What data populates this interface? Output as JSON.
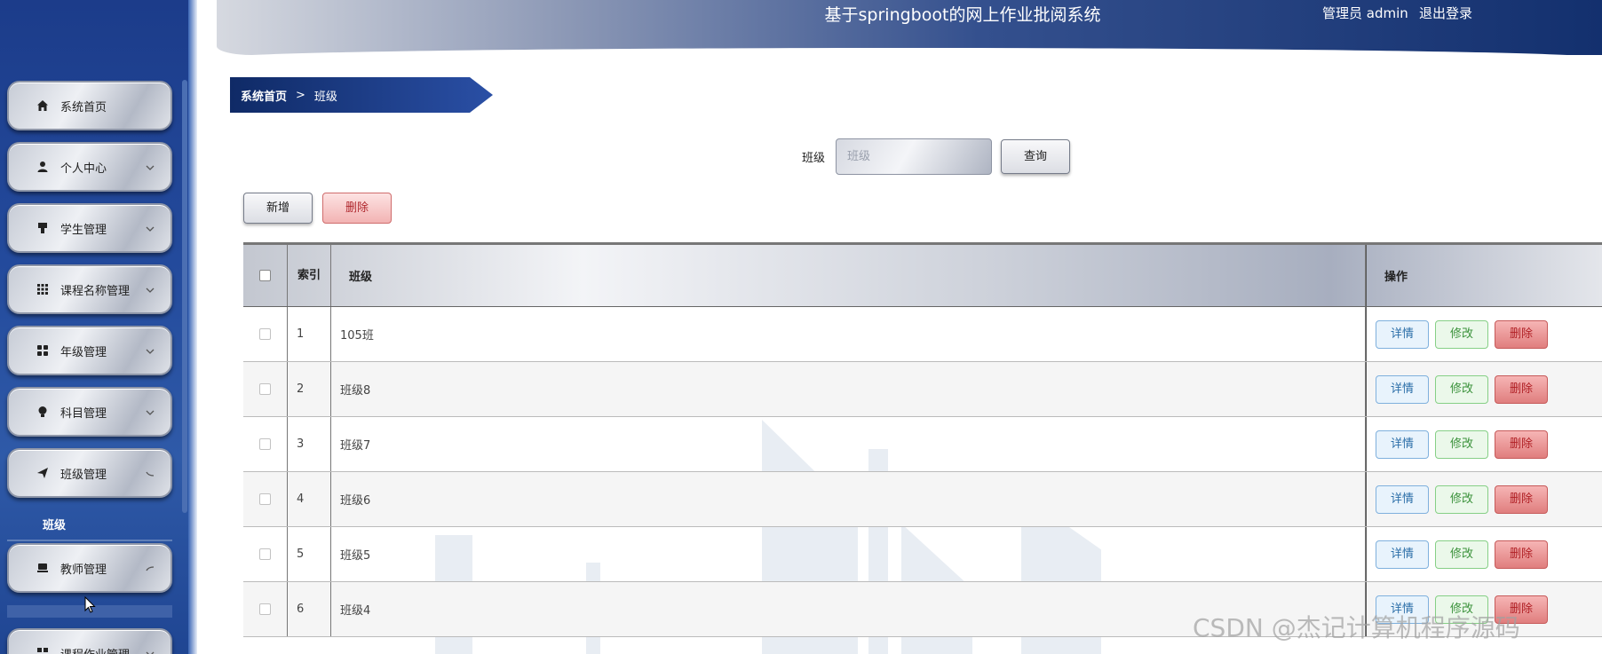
{
  "header": {
    "title": "基于springboot的网上作业批阅系统",
    "user_label": "管理员 admin",
    "logout_label": "退出登录"
  },
  "sidebar": {
    "items": [
      {
        "label": "系统首页",
        "icon": "home-icon",
        "arrow": ""
      },
      {
        "label": "个人中心",
        "icon": "user-icon",
        "arrow": "chevron-down"
      },
      {
        "label": "学生管理",
        "icon": "student-icon",
        "arrow": "chevron-down"
      },
      {
        "label": "课程名称管理",
        "icon": "grid-icon",
        "arrow": "chevron-down"
      },
      {
        "label": "年级管理",
        "icon": "apps-icon",
        "arrow": "chevron-down"
      },
      {
        "label": "科目管理",
        "icon": "bulb-icon",
        "arrow": "chevron-down"
      },
      {
        "label": "班级管理",
        "icon": "send-icon",
        "arrow": "chevron-up"
      },
      {
        "label": "教师管理",
        "icon": "teacher-icon",
        "arrow": "chevron-up"
      },
      {
        "label": "课程作业管理",
        "icon": "grid-icon",
        "arrow": "chevron-down"
      }
    ],
    "active_submenu": "班级"
  },
  "breadcrumb": {
    "home": "系统首页",
    "separator": ">",
    "current": "班级"
  },
  "search": {
    "label": "班级",
    "placeholder": "班级",
    "button": "查询"
  },
  "actions": {
    "add": "新增",
    "delete": "删除"
  },
  "table": {
    "headers": {
      "index": "索引",
      "name": "班级",
      "ops": "操作"
    },
    "rows": [
      {
        "index": "1",
        "name": "105班"
      },
      {
        "index": "2",
        "name": "班级8"
      },
      {
        "index": "3",
        "name": "班级7"
      },
      {
        "index": "4",
        "name": "班级6"
      },
      {
        "index": "5",
        "name": "班级5"
      },
      {
        "index": "6",
        "name": "班级4"
      }
    ],
    "row_ops": {
      "detail": "详情",
      "edit": "修改",
      "delete": "删除"
    }
  },
  "watermark": "CSDN @杰记计算机程序源码",
  "colors": {
    "sidebar": "#234a9c",
    "header_dark": "#13306e",
    "danger": "#e07e7e",
    "success": "#86cf86",
    "info": "#7fb0dd"
  }
}
